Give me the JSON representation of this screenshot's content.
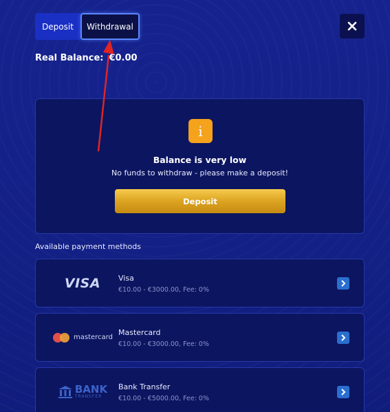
{
  "tabs": {
    "deposit_label": "Deposit",
    "withdrawal_label": "Withdrawal",
    "active": "Withdrawal"
  },
  "close_icon": "close-icon",
  "balance": {
    "label": "Real Balance:",
    "amount": "€0.00"
  },
  "notice": {
    "icon": "info-icon",
    "icon_glyph": "i",
    "title": "Balance is very low",
    "message": "No funds to withdraw - please make a deposit!",
    "button_label": "Deposit"
  },
  "methods_heading": "Available payment methods",
  "methods": [
    {
      "logo": "visa-logo",
      "logo_text": "VISA",
      "name": "Visa",
      "range": "€10.00 - €3000.00, Fee: 0%"
    },
    {
      "logo": "mastercard-logo",
      "logo_text": "mastercard",
      "name": "Mastercard",
      "range": "€10.00 - €3000.00, Fee: 0%"
    },
    {
      "logo": "bank-transfer-logo",
      "logo_text": "BANK",
      "logo_subtext": "TRANSFER",
      "name": "Bank Transfer",
      "range": "€10.00 - €5000.00, Fee: 0%"
    }
  ],
  "colors": {
    "background": "#14218a",
    "card": "#0c1560",
    "accent_orange": "#f5a21c",
    "button_gold": "#dca421",
    "arrow_red": "#e02424",
    "chevron_blue": "#2a6fd0"
  }
}
